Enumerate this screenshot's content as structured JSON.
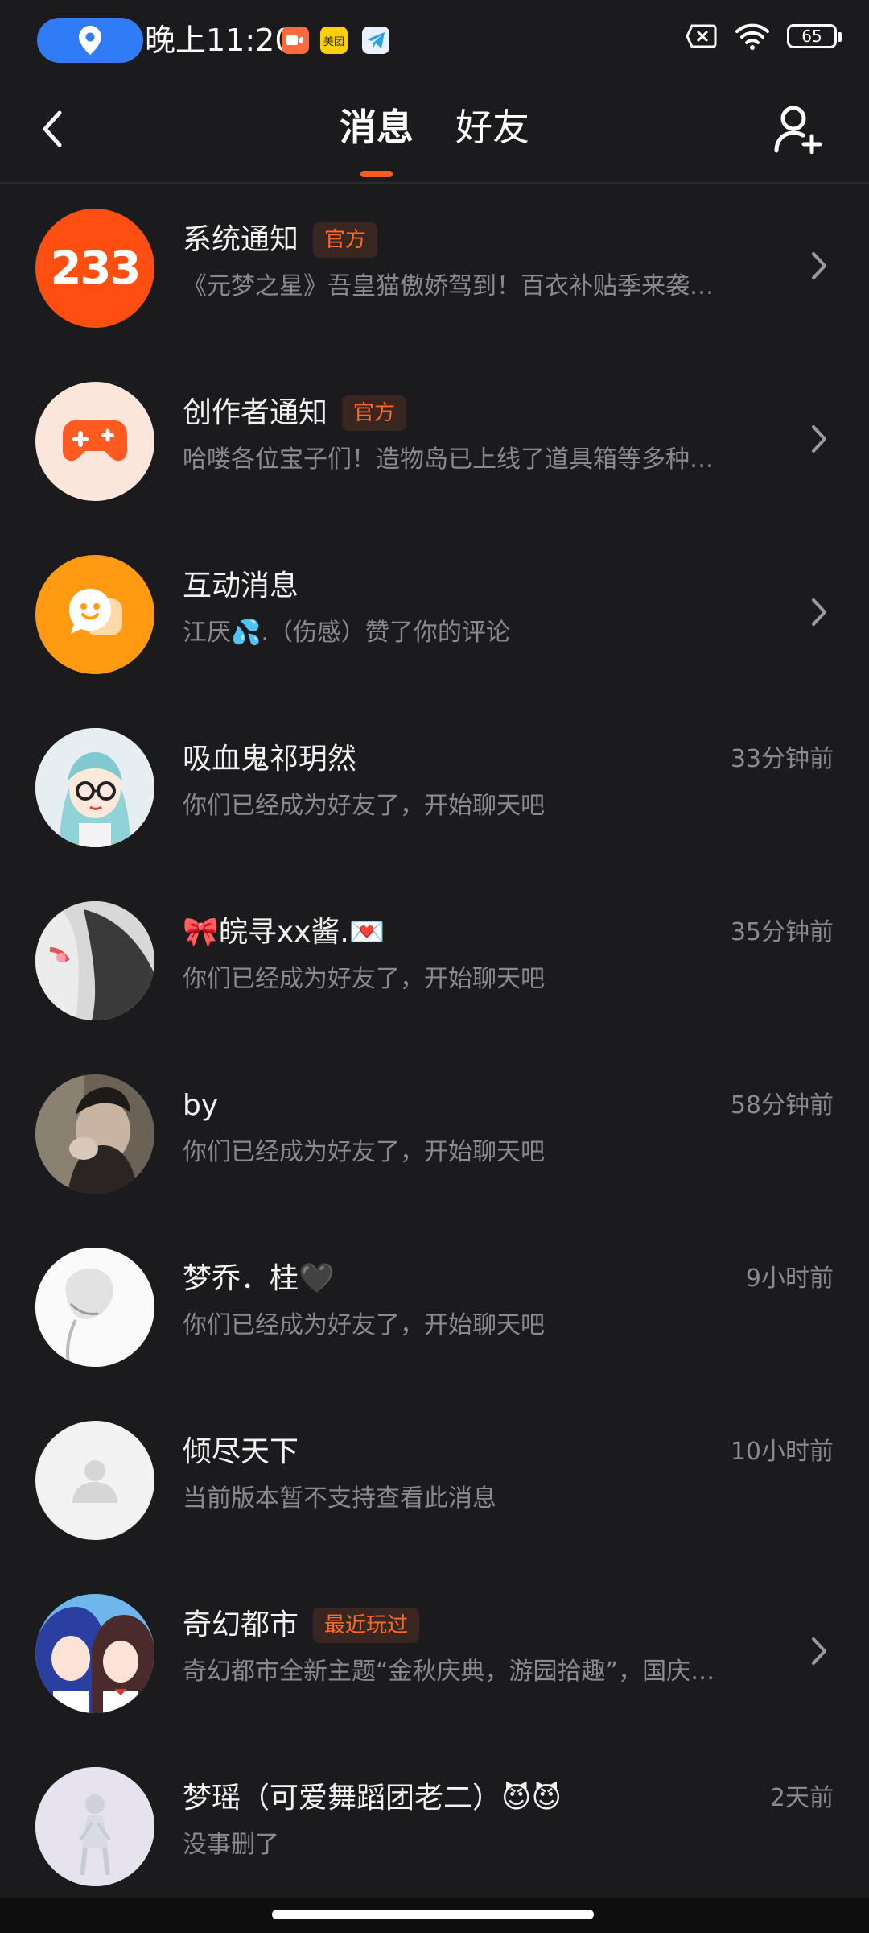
{
  "status_bar": {
    "time": "晚上11:20",
    "app_icons": [
      "video-app-icon",
      "meituan-icon",
      "telegram-icon"
    ],
    "meituan_label": "美团",
    "battery": "65"
  },
  "nav": {
    "tabs": [
      {
        "label": "消息",
        "active": true
      },
      {
        "label": "好友",
        "active": false
      }
    ]
  },
  "messages": [
    {
      "name": "系统通知",
      "badge": "官方",
      "preview": "《元梦之星》吾皇猫傲娇驾到！百衣补贴季来袭…",
      "time": "",
      "chevron": true,
      "avatar_text": "233"
    },
    {
      "name": "创作者通知",
      "badge": "官方",
      "preview": "哈喽各位宝子们！造物岛已上线了道具箱等多种…",
      "time": "",
      "chevron": true
    },
    {
      "name": "互动消息",
      "badge": "",
      "preview": "江厌💦.（伤感）赞了你的评论",
      "time": "",
      "chevron": true
    },
    {
      "name": "吸血鬼祁玥然",
      "badge": "",
      "preview": "你们已经成为好友了，开始聊天吧",
      "time": "33分钟前",
      "chevron": false
    },
    {
      "name": "🎀皖寻xx酱.💌",
      "badge": "",
      "preview": "你们已经成为好友了，开始聊天吧",
      "time": "35分钟前",
      "chevron": false
    },
    {
      "name": "by",
      "badge": "",
      "preview": "你们已经成为好友了，开始聊天吧",
      "time": "58分钟前",
      "chevron": false
    },
    {
      "name": "梦乔．桂🖤",
      "badge": "",
      "preview": "你们已经成为好友了，开始聊天吧",
      "time": "9小时前",
      "chevron": false
    },
    {
      "name": "倾尽天下",
      "badge": "",
      "preview": "当前版本暂不支持查看此消息",
      "time": "10小时前",
      "chevron": false
    },
    {
      "name": "奇幻都市",
      "badge": "最近玩过",
      "preview": "奇幻都市全新主题“金秋庆典，游园拾趣”，国庆…",
      "time": "",
      "chevron": true
    },
    {
      "name": "梦瑶（可爱舞蹈团老二）😈😈",
      "badge": "",
      "preview": "没事删了",
      "time": "2天前",
      "chevron": false
    }
  ],
  "colors": {
    "background": "#1b1b1d",
    "accent": "#ff5a1f",
    "badge_text": "#ff6a2a",
    "secondary_text": "#8a8a8e"
  }
}
